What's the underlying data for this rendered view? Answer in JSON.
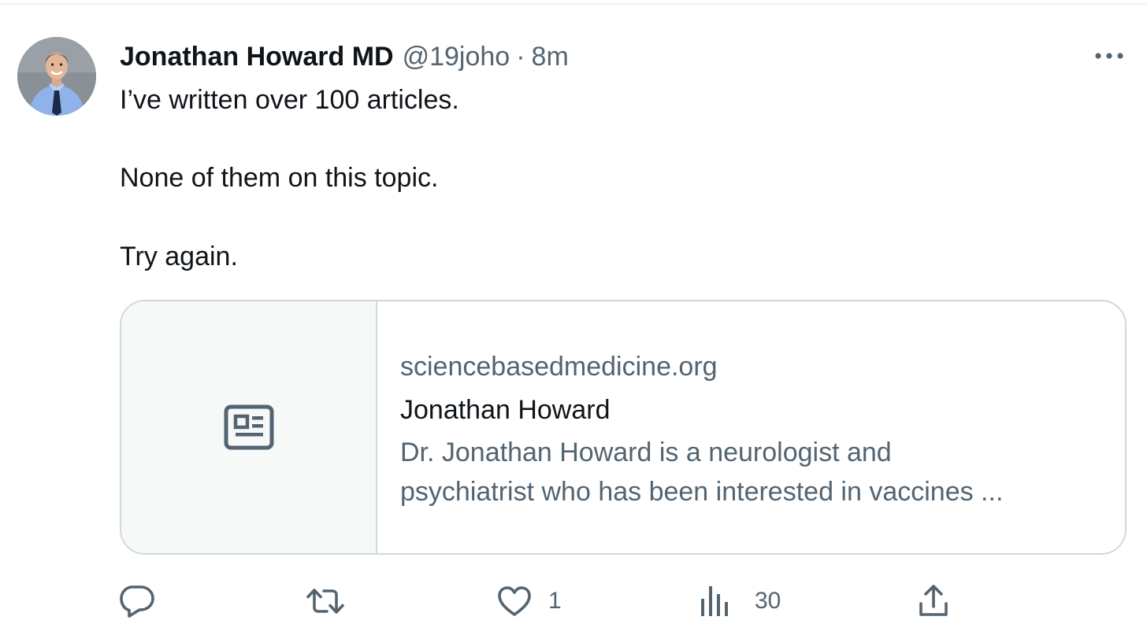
{
  "tweet": {
    "author": {
      "display_name": "Jonathan Howard MD",
      "handle": "@19joho",
      "separator": "·",
      "time": "8m",
      "avatar_icon": "user-avatar"
    },
    "more_icon": "ellipsis-icon",
    "text_lines": [
      "I’ve written over 100 articles.",
      "None of them on this topic.",
      "Try again."
    ],
    "card": {
      "icon": "article-icon",
      "domain": "sciencebasedmedicine.org",
      "title": "Jonathan Howard",
      "description_lines": [
        "Dr. Jonathan Howard is a neurologist and",
        "psychiatrist who has been interested in vaccines ..."
      ]
    },
    "actions": {
      "reply": {
        "icon": "reply-icon",
        "count": ""
      },
      "retweet": {
        "icon": "retweet-icon",
        "count": ""
      },
      "like": {
        "icon": "heart-icon",
        "count": "1"
      },
      "views": {
        "icon": "views-icon",
        "count": "30"
      },
      "share": {
        "icon": "share-icon"
      }
    }
  },
  "colors": {
    "text_primary": "#0f1419",
    "text_secondary": "#536471",
    "border": "#cfd9de",
    "card_media_bg": "#f7f9f9"
  }
}
